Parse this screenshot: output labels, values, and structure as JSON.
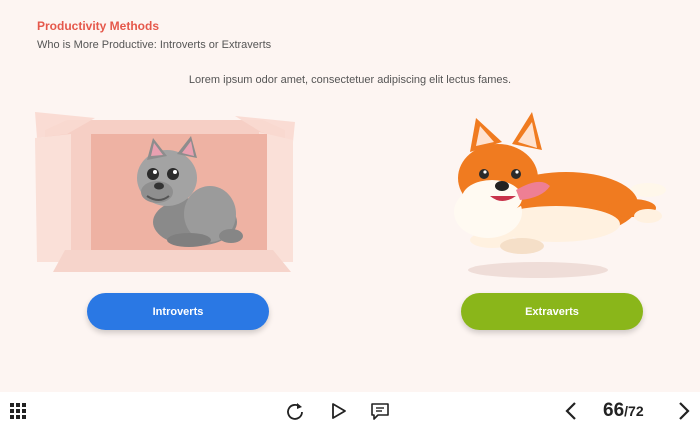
{
  "header": {
    "section_title": "Productivity Methods",
    "subtitle": "Who is More Productive: Introverts or Extraverts"
  },
  "body": {
    "text": "Lorem ipsum odor amet, consectetuer adipiscing elit lectus fames."
  },
  "options": {
    "left_label": "Introverts",
    "right_label": "Extraverts"
  },
  "toolbar": {
    "menu_icon": "grid-menu-icon",
    "replay_icon": "replay-icon",
    "play_icon": "play-icon",
    "notes_icon": "notes-icon",
    "prev_icon": "chevron-left-icon",
    "next_icon": "chevron-right-icon",
    "page_current": "66",
    "page_separator": "/",
    "page_total": "72"
  },
  "colors": {
    "accent_title": "#e5584b",
    "introverts_button": "#2a78e4",
    "extraverts_button": "#8ab61a",
    "slide_background": "#fdf5f2"
  }
}
